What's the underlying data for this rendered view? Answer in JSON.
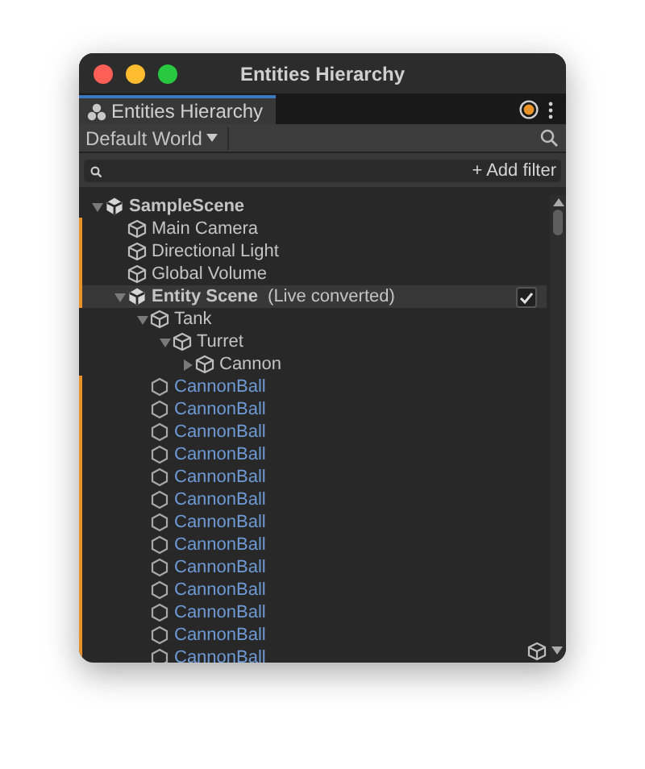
{
  "window": {
    "title": "Entities Hierarchy"
  },
  "tabs": [
    {
      "label": "Entities Hierarchy",
      "selected": true
    }
  ],
  "toolbar": {
    "world": "Default World"
  },
  "search": {
    "button": "+ Add filter"
  },
  "tree": [
    {
      "kind": "scene",
      "label": "SampleScene",
      "expanded": true,
      "modified": false,
      "children": [
        {
          "kind": "gameobject",
          "label": "Main Camera",
          "modified": true
        },
        {
          "kind": "gameobject",
          "label": "Directional Light",
          "modified": true
        },
        {
          "kind": "gameobject",
          "label": "Global Volume",
          "modified": true
        },
        {
          "kind": "subscene",
          "label": "Entity Scene",
          "note": "(Live converted)",
          "checked": true,
          "expanded": true,
          "modified": true,
          "children": [
            {
              "kind": "gameobject",
              "label": "Tank",
              "expanded": true,
              "modified": false,
              "children": [
                {
                  "kind": "gameobject",
                  "label": "Turret",
                  "expanded": true,
                  "modified": false,
                  "children": [
                    {
                      "kind": "gameobject",
                      "label": "Cannon",
                      "expanded": false,
                      "modified": false
                    }
                  ]
                }
              ]
            },
            {
              "kind": "entity",
              "label": "CannonBall",
              "modified": true
            },
            {
              "kind": "entity",
              "label": "CannonBall",
              "modified": true
            },
            {
              "kind": "entity",
              "label": "CannonBall",
              "modified": true
            },
            {
              "kind": "entity",
              "label": "CannonBall",
              "modified": true
            },
            {
              "kind": "entity",
              "label": "CannonBall",
              "modified": true
            },
            {
              "kind": "entity",
              "label": "CannonBall",
              "modified": true
            },
            {
              "kind": "entity",
              "label": "CannonBall",
              "modified": true
            },
            {
              "kind": "entity",
              "label": "CannonBall",
              "modified": true
            },
            {
              "kind": "entity",
              "label": "CannonBall",
              "modified": true
            },
            {
              "kind": "entity",
              "label": "CannonBall",
              "modified": true
            },
            {
              "kind": "entity",
              "label": "CannonBall",
              "modified": true
            },
            {
              "kind": "entity",
              "label": "CannonBall",
              "modified": true
            },
            {
              "kind": "entity",
              "label": "CannonBall",
              "modified": true
            }
          ]
        }
      ]
    }
  ]
}
